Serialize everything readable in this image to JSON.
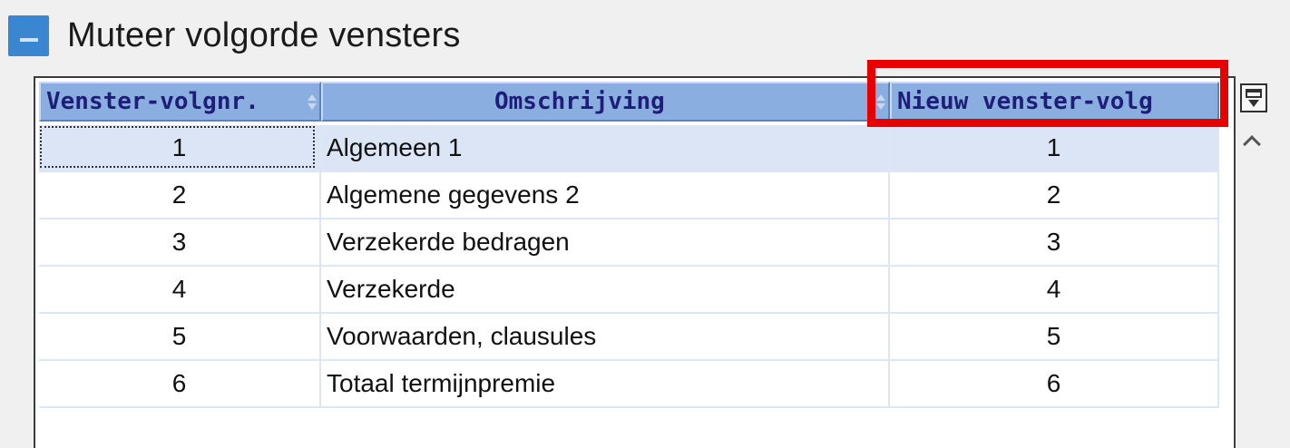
{
  "window": {
    "title": "Muteer volgorde vensters"
  },
  "grid": {
    "columns": [
      {
        "label": "Venster-volgnr."
      },
      {
        "label": "Omschrijving"
      },
      {
        "label": "Nieuw venster-volg"
      }
    ],
    "rows": [
      {
        "volgnr": "1",
        "omschrijving": "Algemeen 1",
        "nieuw": "1",
        "selected": true
      },
      {
        "volgnr": "2",
        "omschrijving": "Algemene gegevens 2",
        "nieuw": "2"
      },
      {
        "volgnr": "3",
        "omschrijving": "Verzekerde bedragen",
        "nieuw": "3"
      },
      {
        "volgnr": "4",
        "omschrijving": "Verzekerde",
        "nieuw": "4"
      },
      {
        "volgnr": "5",
        "omschrijving": "Voorwaarden, clausules",
        "nieuw": "5"
      },
      {
        "volgnr": "6",
        "omschrijving": "Totaal termijnpremie",
        "nieuw": "6"
      }
    ]
  },
  "icons": {
    "app": "app-logo-icon",
    "column_chooser": "column-chooser-icon",
    "scroll_up": "chevron-up-icon",
    "sort": "sort-icon"
  },
  "colors": {
    "header_bg": "#8aaee0",
    "header_text": "#1e1e78",
    "selected_row": "#dbe5f6",
    "highlight": "#e60000"
  }
}
